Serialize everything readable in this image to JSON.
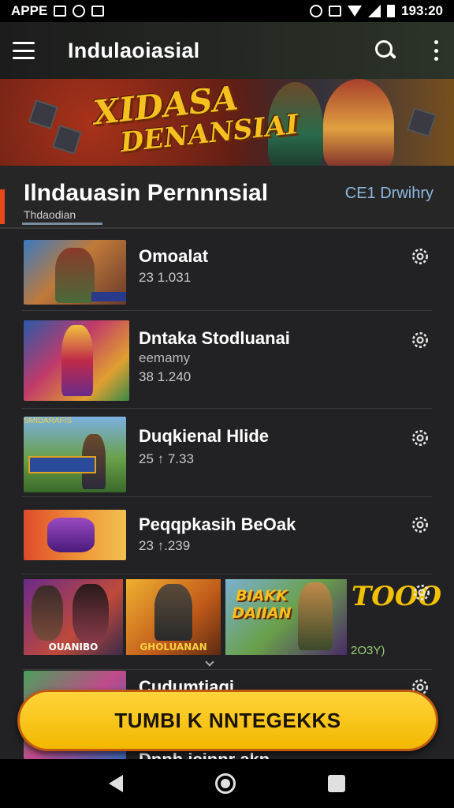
{
  "status_bar": {
    "left_label": "APPE",
    "time": "193:20",
    "icons": [
      "image-icon",
      "circle-icon",
      "box-icon",
      "sync-icon",
      "vibrate-icon",
      "wifi-icon",
      "signal-icon",
      "battery-icon"
    ]
  },
  "app_bar": {
    "title": "Indulaoiasial",
    "icons": [
      "menu-icon",
      "search-icon",
      "more-vert-icon"
    ]
  },
  "banner": {
    "line1": "XIDASA",
    "line2": "DENANSIAI"
  },
  "section": {
    "title": "Ilndauasin Pernnnsial",
    "subtitle": "Thdaodian",
    "link": "CE1 Drwihry",
    "accent_color": "#e8491a"
  },
  "items": [
    {
      "title": "Omoalat",
      "subtitle": "",
      "meta": "23 1.031"
    },
    {
      "title": "Dntaka Stodluanai",
      "subtitle": "eemamy",
      "meta": "38 1.240"
    },
    {
      "title": "Duqkienal Hlide",
      "subtitle": "",
      "meta": "25 ↑ 7.33"
    },
    {
      "title": "Peqqpkasih BeOak",
      "subtitle": "",
      "meta": "23 ↑.239"
    },
    {
      "title": "Cudumtiagi",
      "subtitle": "",
      "meta": ""
    },
    {
      "title": "Dnnh icinnr akn",
      "subtitle": "",
      "meta": ""
    }
  ],
  "thumb_labels": [
    "",
    "",
    "SMIDARAFIS",
    ""
  ],
  "strip": {
    "cards": [
      {
        "label": "OUANIBO"
      },
      {
        "label": "GHOLUANAN"
      },
      {
        "label": "BIAKK DAIIAN"
      }
    ],
    "big_caption": "TOOO",
    "value": "2O3Y)"
  },
  "cta": {
    "label": "TUMBI K NNTEGEKKS"
  },
  "nav": {
    "icons": [
      "back-icon",
      "home-icon",
      "recents-icon"
    ]
  }
}
